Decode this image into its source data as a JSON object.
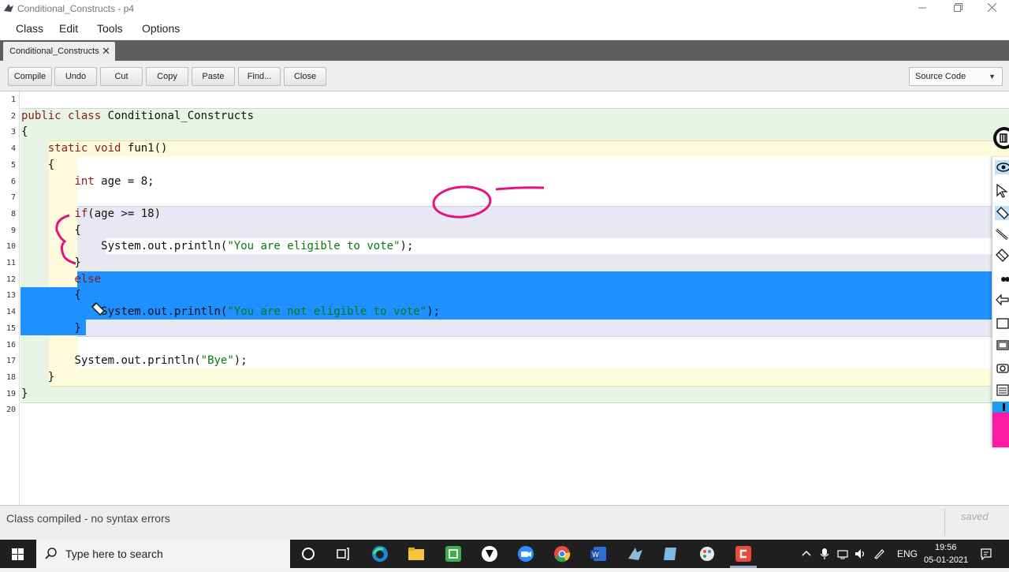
{
  "window": {
    "title": "Conditional_Constructs - p4"
  },
  "menu": [
    "Class",
    "Edit",
    "Tools",
    "Options"
  ],
  "tab": {
    "label": "Conditional_Constructs",
    "close": "✕"
  },
  "toolbar": {
    "buttons": [
      "Compile",
      "Undo",
      "Cut",
      "Copy",
      "Paste",
      "Find...",
      "Close"
    ],
    "view_select": "Source Code"
  },
  "editor": {
    "line_numbers": [
      "1",
      "2",
      "3",
      "4",
      "5",
      "6",
      "7",
      "8",
      "9",
      "10",
      "11",
      "12",
      "13",
      "14",
      "15",
      "16",
      "17",
      "18",
      "19",
      "20"
    ],
    "lines": [
      "",
      "public class Conditional_Constructs",
      "{",
      "    static void fun1()",
      "    {",
      "        int age = 8;",
      "",
      "        if(age >= 18)",
      "        {",
      "            System.out.println(\"You are eligible to vote\");",
      "        }",
      "        else",
      "        {",
      "            System.out.println(\"You are not eligible to vote\");",
      "        }",
      "",
      "        System.out.println(\"Bye\");",
      "    }",
      "}",
      ""
    ],
    "selected_lines": [
      12,
      13,
      14,
      15
    ]
  },
  "status": {
    "message": "Class compiled - no syntax errors",
    "saved": "saved"
  },
  "taskbar": {
    "search_placeholder": "Type here to search",
    "language": "ENG",
    "time": "19:56",
    "date": "05-01-2021"
  },
  "colors": {
    "class_scope": "#e8f5e6",
    "method_scope": "#fdfbdc",
    "if_scope": "#e8e8f4",
    "selection": "#1e90ff",
    "ink": "#e4137f"
  }
}
